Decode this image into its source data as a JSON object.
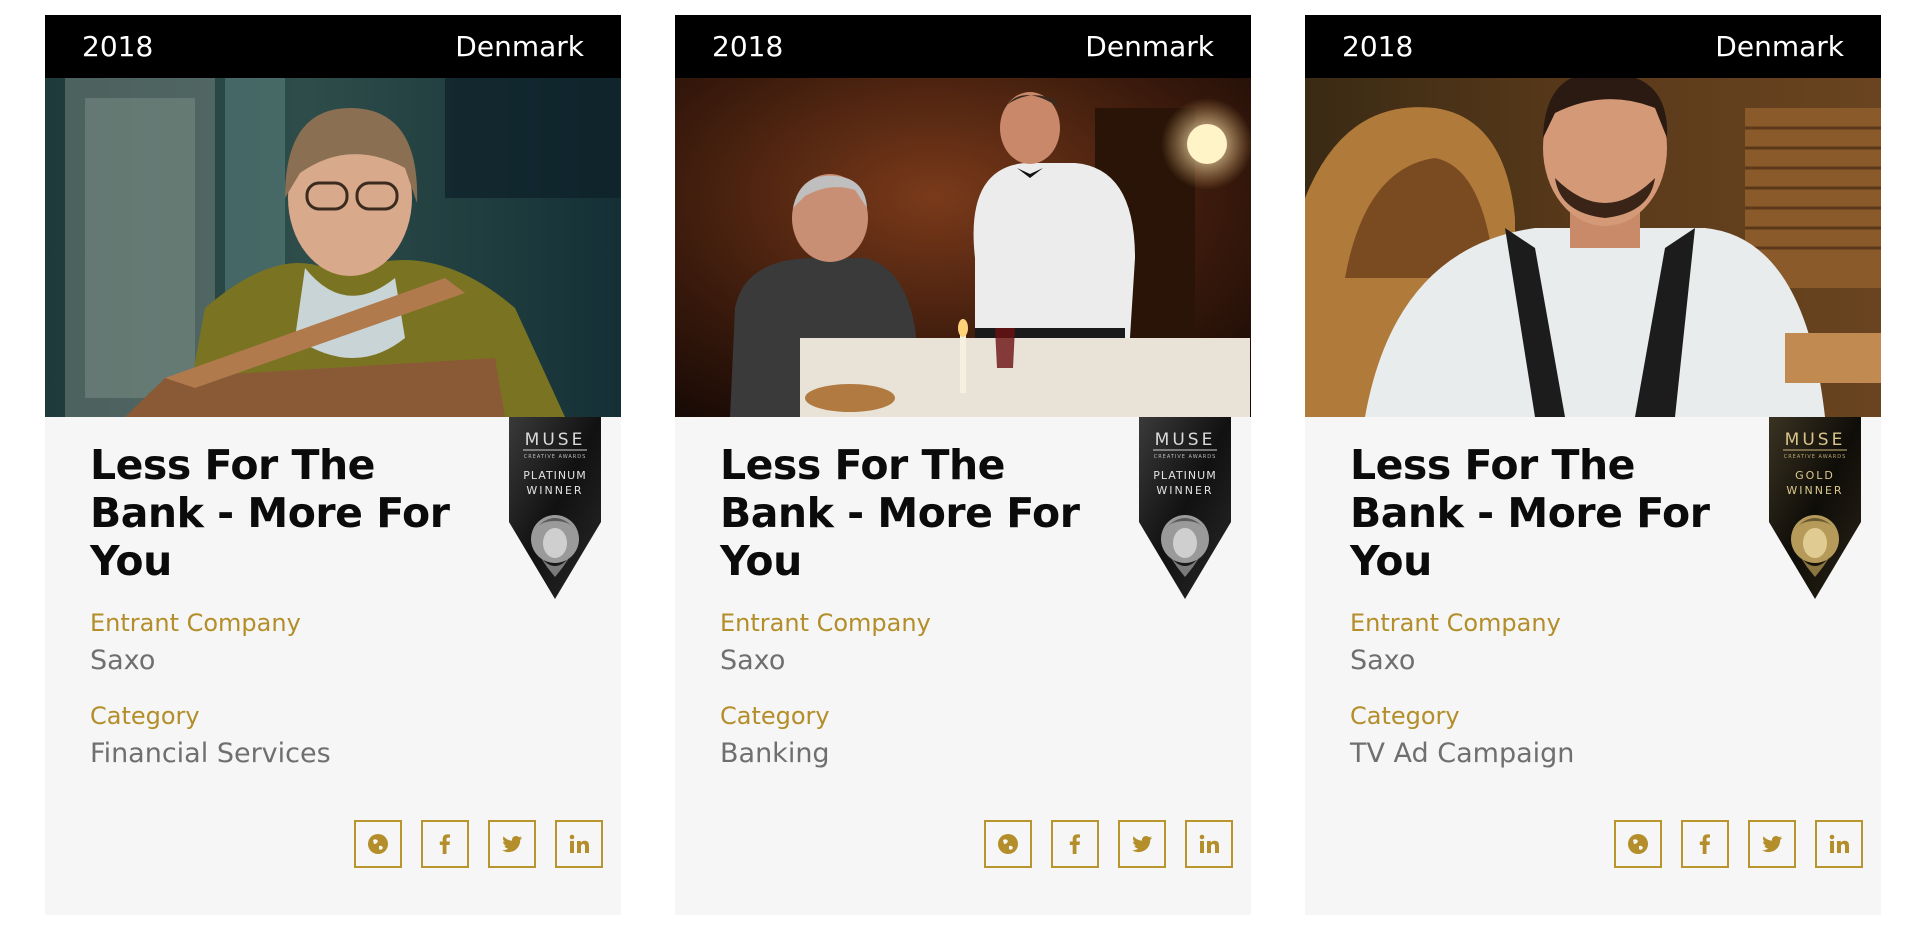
{
  "cards": [
    {
      "year": "2018",
      "country": "Denmark",
      "title": "Less For The Bank - More For You",
      "entrant_label": "Entrant Company",
      "entrant": "Saxo",
      "category_label": "Category",
      "category": "Financial Services",
      "badge": {
        "brand": "MUSE",
        "sub": "CREATIVE AWARDS",
        "level": "PLATINUM",
        "status": "WINNER"
      }
    },
    {
      "year": "2018",
      "country": "Denmark",
      "title": "Less For The Bank - More For You",
      "entrant_label": "Entrant Company",
      "entrant": "Saxo",
      "category_label": "Category",
      "category": "Banking",
      "badge": {
        "brand": "MUSE",
        "sub": "CREATIVE AWARDS",
        "level": "PLATINUM",
        "status": "WINNER"
      }
    },
    {
      "year": "2018",
      "country": "Denmark",
      "title": "Less For The Bank - More For You",
      "entrant_label": "Entrant Company",
      "entrant": "Saxo",
      "category_label": "Category",
      "category": "TV Ad Campaign",
      "badge": {
        "brand": "MUSE",
        "sub": "CREATIVE AWARDS",
        "level": "GOLD",
        "status": "WINNER"
      }
    }
  ],
  "social_icons": [
    "globe-icon",
    "facebook-icon",
    "twitter-icon",
    "linkedin-icon"
  ],
  "colors": {
    "accent": "#b38e2a",
    "card_bg": "#f5f6f5",
    "header_bg": "#000000",
    "value_text": "#6f6f6f"
  }
}
